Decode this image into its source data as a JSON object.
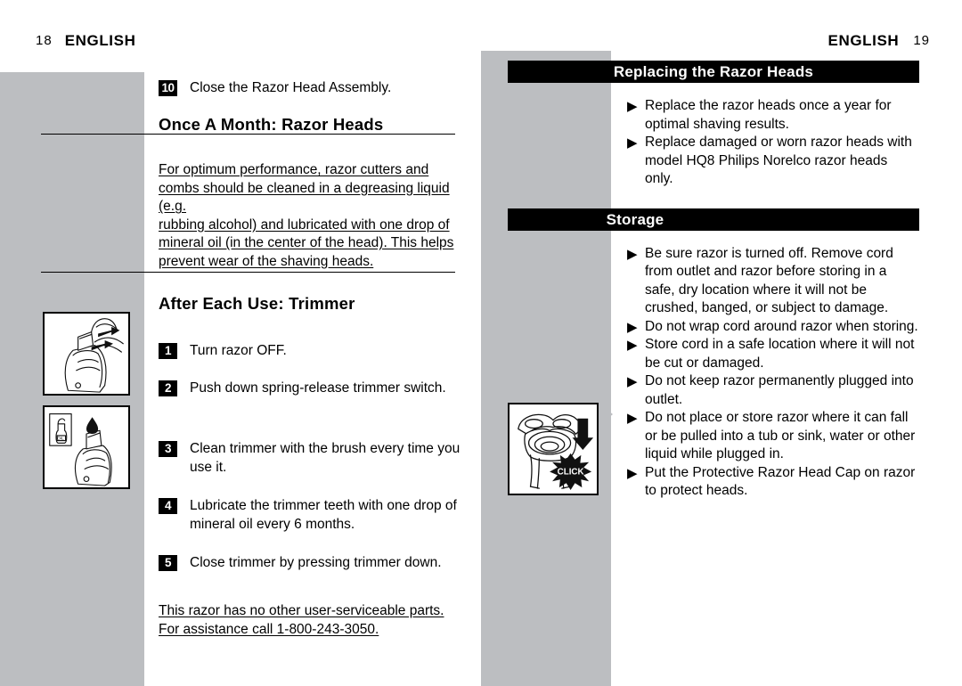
{
  "document": {
    "type": "user-manual-spread",
    "colors": {
      "panel_gray": "#bcbec1",
      "band_black": "#000000",
      "text_black": "#000000",
      "paper_white": "#ffffff"
    }
  },
  "left_page": {
    "folio": "18",
    "running_head": "ENGLISH",
    "lead_step": {
      "number": "10",
      "text": "Close the Razor Head Assembly."
    },
    "section_once_a_month": {
      "title": "Once A Month:  Razor Heads",
      "paragraph_lines": [
        "For optimum performance, razor cutters and",
        "combs should be cleaned in a degreasing liquid (e.g.",
        "rubbing alcohol) and lubricated with one drop of",
        "mineral oil (in the center of the head). This helps",
        "prevent wear of the shaving heads."
      ]
    },
    "section_after_each_use": {
      "title": "After Each Use: Trimmer",
      "steps": [
        {
          "number": "1",
          "text": "Turn razor OFF."
        },
        {
          "number": "2",
          "text": "Push down spring-release trimmer switch."
        },
        {
          "number": "3",
          "text": "Clean trimmer with the brush every time you use it."
        },
        {
          "number": "4",
          "text": "Lubricate the trimmer teeth with one drop of mineral oil every 6 months."
        },
        {
          "number": "5",
          "text": "Close trimmer by pressing trimmer down."
        }
      ]
    },
    "footnote_lines": [
      "This razor has no other user-serviceable parts.",
      "For assistance call  1-800-243-3050."
    ],
    "illustrations": [
      {
        "name": "trimmer-spring-release-illustration",
        "caption": "Razor with trimmer opening, two arrows"
      },
      {
        "name": "trimmer-oil-drop-illustration",
        "caption": "Oil bottle and drop of oil on trimmer",
        "bottle_label": "OIL"
      }
    ]
  },
  "right_page": {
    "folio": "19",
    "running_head": "ENGLISH",
    "section_replacing": {
      "band_title": "Replacing the Razor Heads",
      "bullets": [
        "Replace the razor heads once a year for optimal shaving results.",
        "Replace damaged or worn razor heads with model HQ8 Philips Norelco razor heads only."
      ]
    },
    "section_storage": {
      "band_title": "Storage",
      "bullets": [
        "Be sure razor is turned off. Remove cord from outlet and razor before storing in a safe, dry location where it will not be crushed, banged, or subject to damage.",
        "Do not wrap cord around razor when storing.",
        "Store cord in a safe location where it will not be cut or damaged.",
        "Do not keep razor permanently plugged into outlet.",
        "Do not place or store razor where it can fall or be pulled into a tub or sink, water or other liquid while plugged in.",
        "Put the Protective Razor Head Cap on razor to protect heads."
      ]
    },
    "illustrations": [
      {
        "name": "razor-head-cap-click-illustration",
        "caption": "Razor head cap pressed down onto razor",
        "burst_label": "CLICK"
      }
    ]
  },
  "glyphs": {
    "bullet_triangle": "❯",
    "bullet_solid": "▶"
  }
}
